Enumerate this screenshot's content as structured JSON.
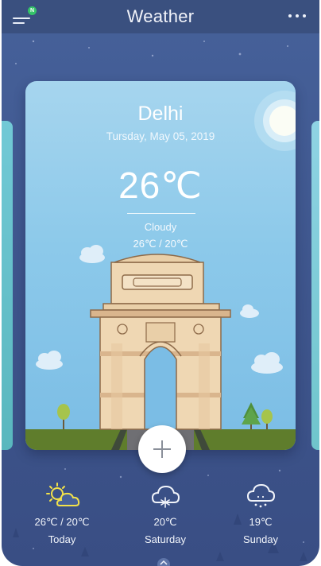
{
  "header": {
    "title": "Weather",
    "notification_badge": "N"
  },
  "current": {
    "city": "Delhi",
    "date": "Tursday, May 05, 2019",
    "temperature": "26℃",
    "condition": "Cloudy",
    "range": "26℃ / 20℃",
    "landmark_icon": "india-gate-illustration"
  },
  "forecast": [
    {
      "temp": "26℃ / 20℃",
      "day": "Today",
      "icon": "sun-behind-cloud-icon"
    },
    {
      "temp": "20℃",
      "day": "Saturday",
      "icon": "snow-cloud-icon"
    },
    {
      "temp": "19℃",
      "day": "Sunday",
      "icon": "snow-cloud-icon"
    }
  ],
  "colors": {
    "background": "#3e558c",
    "header": "#3a507f",
    "card_sky": "#8cc9ea",
    "sun_icon": "#f3e24a",
    "grass": "#5f7d2c"
  }
}
